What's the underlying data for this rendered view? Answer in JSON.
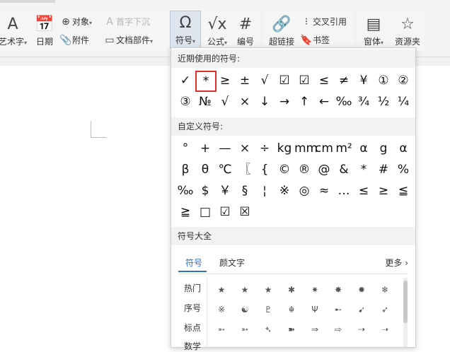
{
  "ribbon": {
    "art_text": "艺术字",
    "date": "日期",
    "object": "对象",
    "dropcap": "首字下沉",
    "attachment": "附件",
    "doc_part": "文档部件",
    "symbol": "符号",
    "formula": "公式",
    "number": "编号",
    "hyperlink": "超链接",
    "cross_ref": "交叉引用",
    "bookmark": "书签",
    "window": "窗体",
    "resource": "资源夹",
    "dropdown_arrow": "▾"
  },
  "panel": {
    "recent_title": "近期使用的符号:",
    "recent": [
      "✓",
      "*",
      "≥",
      "±",
      "√",
      "☑",
      "☑",
      "≤",
      "≠",
      "¥",
      "①",
      "②",
      "③",
      "№",
      "√",
      "×",
      "↓",
      "→",
      "↑",
      "←",
      "‰",
      "¾",
      "½",
      "¼"
    ],
    "custom_title": "自定义符号:",
    "custom": [
      "°",
      "+",
      "—",
      "×",
      "÷",
      "kg",
      "mm",
      "cm",
      "m²",
      "α",
      "g",
      "α",
      "β",
      "θ",
      "℃",
      "〖",
      "{",
      "©",
      "®",
      "@",
      "&",
      "*",
      "#",
      "%",
      "‰",
      "$",
      "￥",
      "§",
      "¦",
      "※",
      "◎",
      "≈",
      "…",
      "≤",
      "≥",
      "≦",
      "≧",
      "□",
      "☑",
      "☒"
    ],
    "all_title": "符号大全",
    "tabs": [
      "符号",
      "颜文字"
    ],
    "more": "更多",
    "more_icon": "chevron-right-icon",
    "categories": [
      "热门",
      "序号",
      "标点",
      "数学"
    ],
    "symbols": [
      "★",
      "★",
      "★",
      "✱",
      "✷",
      "✸",
      "✹",
      "❄",
      "※",
      "☯",
      "♇",
      "☬",
      "Ψ",
      "➸",
      "➹",
      "➶",
      "➵",
      "➳",
      "➴",
      "➽",
      "⇒",
      "⇨",
      "⇢",
      "➝"
    ]
  }
}
